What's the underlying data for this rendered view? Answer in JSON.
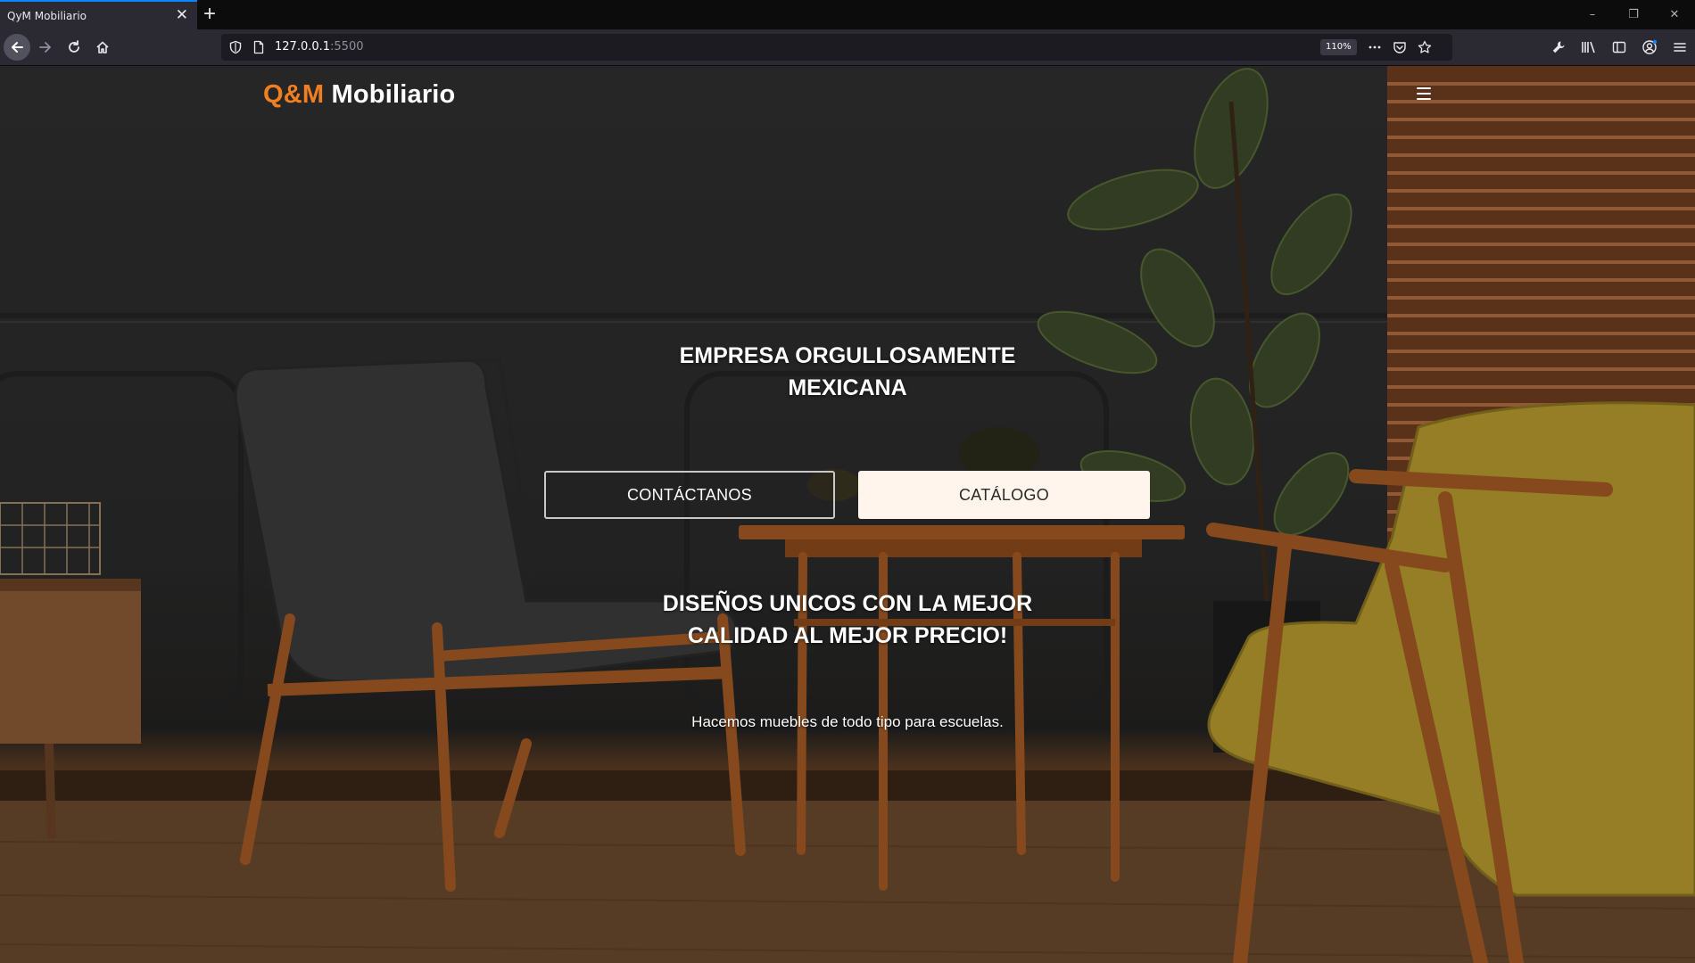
{
  "browser": {
    "tab_title": "QyM Mobiliario",
    "tab_close": "✕",
    "new_tab": "+",
    "url_host": "127.0.0.1",
    "url_port": ":5500",
    "zoom": "110%",
    "window_controls": [
      "–",
      "❐",
      "✕"
    ]
  },
  "site": {
    "brand_accent": "Q&M",
    "brand_name": "Mobiliario",
    "heading_line1": "EMPRESA ORGULLOSAMENTE",
    "heading_line2": "MEXICANA",
    "contact_button": "CONTÁCTANOS",
    "catalog_button": "CATÁLOGO",
    "subheading_line1": "DISEÑOS UNICOS CON LA MEJOR",
    "subheading_line2": "CALIDAD AL MEJOR PRECIO!",
    "tagline": "Hacemos muebles de todo tipo para escuelas."
  },
  "colors": {
    "brand_accent": "#f07f22",
    "tab_highlight": "#0a84ff",
    "catalog_button_bg": "#fff5ec"
  },
  "icons": [
    "back-arrow-icon",
    "forward-arrow-icon",
    "reload-icon",
    "home-icon",
    "shield-icon",
    "page-icon",
    "more-actions-icon",
    "pocket-icon",
    "bookmark-star-icon",
    "wrench-icon",
    "library-icon",
    "sidebar-icon",
    "account-icon",
    "menu-icon",
    "hamburger-menu-icon"
  ]
}
